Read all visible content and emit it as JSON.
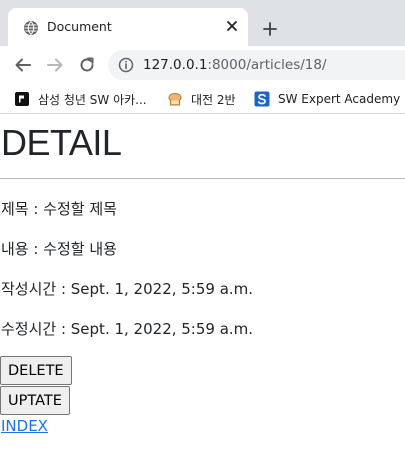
{
  "browser": {
    "tab": {
      "title": "Document",
      "favicon": "globe-icon",
      "close_icon": "close-icon"
    },
    "new_tab_icon": "plus-icon",
    "toolbar": {
      "back_icon": "back-arrow-icon",
      "forward_icon": "forward-arrow-icon",
      "reload_icon": "reload-icon",
      "url_host": "127.0.0.1",
      "url_rest": ":8000/articles/18/"
    },
    "bookmarks": [
      {
        "label": "삼성 청년 SW 아카...",
        "icon": "samsung-academy-icon"
      },
      {
        "label": "대전 2반",
        "icon": "bread-icon"
      },
      {
        "label": "SW Expert Academy",
        "icon": "swea-icon"
      }
    ]
  },
  "page": {
    "heading": "DETAIL",
    "title_line": "제목 : 수정할 제목",
    "content_line": "내용 : 수정할 내용",
    "created_line": "작성시간 : Sept. 1, 2022, 5:59 a.m.",
    "updated_line": "수정시간 : Sept. 1, 2022, 5:59 a.m.",
    "delete_label": "DELETE",
    "update_label": "UPTATE",
    "index_link": "INDEX"
  },
  "colors": {
    "tabstrip_bg": "#dee1e6",
    "omnibox_bg": "#f1f3f4",
    "link": "#1a73e8",
    "swea_blue": "#1e64c8"
  }
}
